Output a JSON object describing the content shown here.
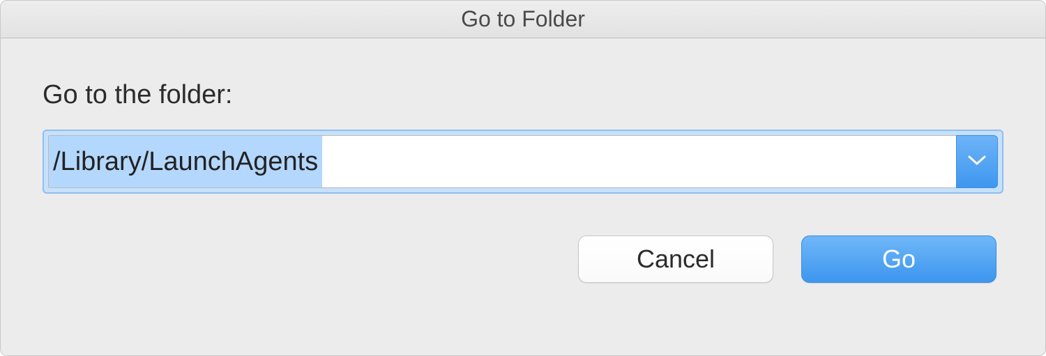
{
  "dialog": {
    "title": "Go to Folder",
    "prompt": "Go to the folder:",
    "path_value": "/Library/LaunchAgents",
    "buttons": {
      "cancel": "Cancel",
      "go": "Go"
    }
  }
}
